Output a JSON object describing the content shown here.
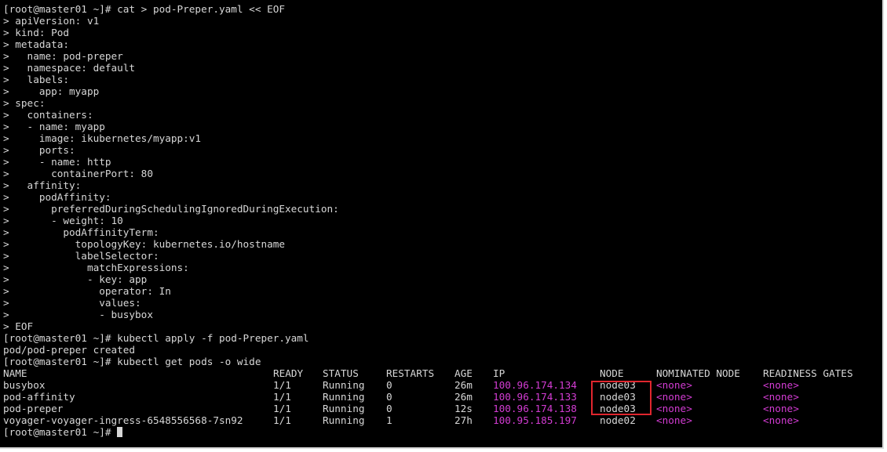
{
  "terminal": {
    "heredoc_lines": [
      "[root@master01 ~]# cat > pod-Preper.yaml << EOF",
      "> apiVersion: v1",
      "> kind: Pod",
      "> metadata:",
      ">   name: pod-preper",
      ">   namespace: default",
      ">   labels:",
      ">     app: myapp",
      "> spec:",
      ">   containers:",
      ">   - name: myapp",
      ">     image: ikubernetes/myapp:v1",
      ">     ports:",
      ">     - name: http",
      ">       containerPort: 80",
      ">   affinity:",
      ">     podAffinity:",
      ">       preferredDuringSchedulingIgnoredDuringExecution:",
      ">       - weight: 10",
      ">         podAffinityTerm:",
      ">           topologyKey: kubernetes.io/hostname",
      ">           labelSelector:",
      ">             matchExpressions:",
      ">             - key: app",
      ">               operator: In",
      ">               values:",
      ">               - busybox",
      "> EOF",
      "[root@master01 ~]# kubectl apply -f pod-Preper.yaml",
      "pod/pod-preper created",
      "[root@master01 ~]# kubectl get pods -o wide"
    ],
    "table": {
      "headers": {
        "name": "NAME",
        "ready": "READY",
        "status": "STATUS",
        "restarts": "RESTARTS",
        "age": "AGE",
        "ip": "IP",
        "node": "NODE",
        "nominated": "NOMINATED NODE",
        "gates": "READINESS GATES"
      },
      "rows": [
        {
          "name": "busybox",
          "ready": "1/1",
          "status": "Running",
          "restarts": "0",
          "age": "26m",
          "ip": "100.96.174.134",
          "node": "node03",
          "nominated": "<none>",
          "gates": "<none>"
        },
        {
          "name": "pod-affinity",
          "ready": "1/1",
          "status": "Running",
          "restarts": "0",
          "age": "26m",
          "ip": "100.96.174.133",
          "node": "node03",
          "nominated": "<none>",
          "gates": "<none>"
        },
        {
          "name": "pod-preper",
          "ready": "1/1",
          "status": "Running",
          "restarts": "0",
          "age": "12s",
          "ip": "100.96.174.138",
          "node": "node03",
          "nominated": "<none>",
          "gates": "<none>"
        },
        {
          "name": "voyager-voyager-ingress-6548556568-7sn92",
          "ready": "1/1",
          "status": "Running",
          "restarts": "1",
          "age": "27h",
          "ip": "100.95.185.197",
          "node": "node02",
          "nominated": "<none>",
          "gates": "<none>"
        }
      ]
    },
    "final_prompt": "[root@master01 ~]# ",
    "colors": {
      "background": "#000000",
      "foreground": "#d7d7d7",
      "ip_color": "#d33cd3",
      "highlight_box": "#e0262e"
    }
  }
}
